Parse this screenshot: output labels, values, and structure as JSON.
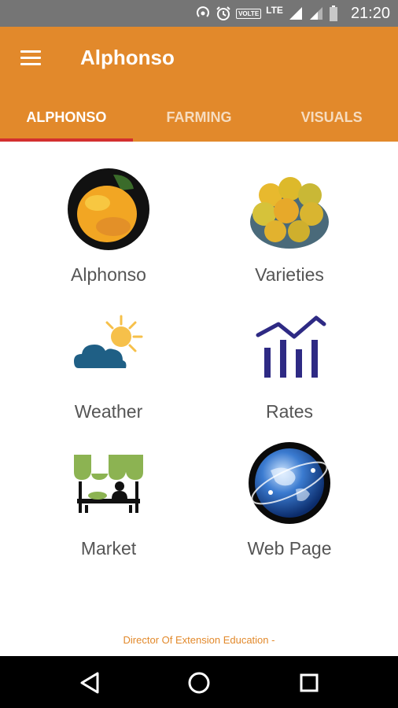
{
  "status_bar": {
    "time": "21:20",
    "volte_label": "VOLTE",
    "network_label": "LTE",
    "icons": [
      "hotspot-icon",
      "alarm-icon",
      "signal-icon",
      "signal-icon",
      "battery-icon"
    ]
  },
  "app_bar": {
    "title": "Alphonso",
    "menu_icon": "menu-icon"
  },
  "tabs": [
    {
      "label": "ALPHONSO",
      "active": true
    },
    {
      "label": "FARMING",
      "active": false
    },
    {
      "label": "VISUALS",
      "active": false
    }
  ],
  "tiles": [
    {
      "label": "Alphonso",
      "icon": "mango-icon"
    },
    {
      "label": "Varieties",
      "icon": "mango-bowl-icon"
    },
    {
      "label": "Weather",
      "icon": "weather-icon"
    },
    {
      "label": "Rates",
      "icon": "rates-chart-icon"
    },
    {
      "label": "Market",
      "icon": "market-stall-icon"
    },
    {
      "label": "Web Page",
      "icon": "globe-icon"
    }
  ],
  "footer": {
    "text": "Director Of Extension Education -"
  },
  "nav_bar": {
    "icons": [
      "back-icon",
      "home-icon",
      "recents-icon"
    ]
  },
  "colors": {
    "primary": "#E2892B",
    "tab_indicator": "#D32F2F",
    "status_bar": "#757575"
  }
}
